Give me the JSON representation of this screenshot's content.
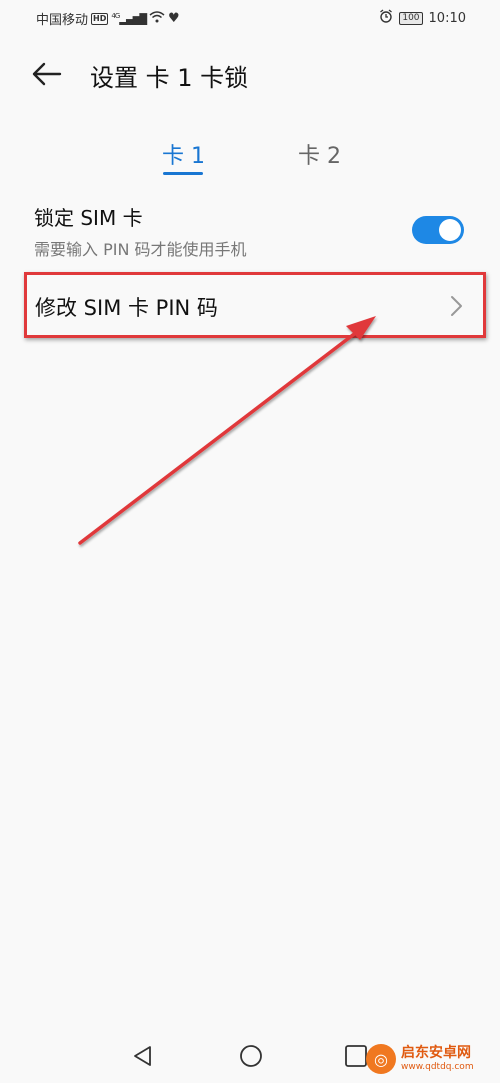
{
  "status": {
    "carrier": "中国移动",
    "hd": "HD",
    "network": "4G",
    "battery": "100",
    "time": "10:10"
  },
  "header": {
    "title": "设置 卡 1 卡锁"
  },
  "tabs": [
    {
      "label": "卡 1",
      "active": true
    },
    {
      "label": "卡 2",
      "active": false
    }
  ],
  "lock_row": {
    "title": "锁定 SIM 卡",
    "subtitle": "需要输入 PIN 码才能使用手机",
    "enabled": true
  },
  "pin_row": {
    "label": "修改 SIM 卡 PIN 码"
  },
  "colors": {
    "accent": "#1976d2",
    "annotation": "#e0393b"
  },
  "watermark": {
    "title": "启东安卓网",
    "url": "www.qdtdq.com"
  }
}
